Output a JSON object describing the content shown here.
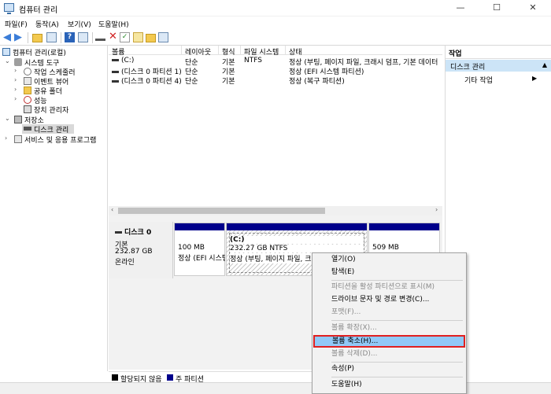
{
  "window": {
    "title": "컴퓨터 관리",
    "min": "—",
    "max": "☐",
    "close": "✕"
  },
  "menu": [
    "파일(F)",
    "동작(A)",
    "보기(V)",
    "도움말(H)"
  ],
  "tree": {
    "root": "컴퓨터 관리(로컬)",
    "system_tools": "시스템 도구",
    "task_scheduler": "작업 스케줄러",
    "event_viewer": "이벤트 뷰어",
    "shared_folders": "공유 폴더",
    "performance": "성능",
    "device_manager": "장치 관리자",
    "storage": "저장소",
    "disk_management": "디스크 관리",
    "services": "서비스 및 응용 프로그램"
  },
  "volume_list": {
    "columns": [
      "볼륨",
      "레이아웃",
      "형식",
      "파일 시스템",
      "상태"
    ],
    "rows": [
      {
        "volume": "(C:)",
        "layout": "단순",
        "type": "기본",
        "fs": "NTFS",
        "status": "정상 (부팅, 페이지 파일, 크래시 덤프, 기본 데이터"
      },
      {
        "volume": "(디스크 0 파티션 1)",
        "layout": "단순",
        "type": "기본",
        "fs": "",
        "status": "정상 (EFI 시스템 파티션)"
      },
      {
        "volume": "(디스크 0 파티션 4)",
        "layout": "단순",
        "type": "기본",
        "fs": "",
        "status": "정상 (복구 파티션)"
      }
    ]
  },
  "disk": {
    "name": "디스크 0",
    "type": "기본",
    "size": "232.87 GB",
    "state": "온라인",
    "partitions": [
      {
        "size": "100 MB",
        "status": "정상 (EFI 시스템)"
      },
      {
        "label": "(C:)",
        "size": "232.27 GB NTFS",
        "status": "정상 (부팅, 페이지 파일, 크래시 덤프)"
      },
      {
        "size": "509 MB",
        "status": ""
      }
    ]
  },
  "legend": [
    "할당되지 않음",
    "주 파티션"
  ],
  "actions": {
    "header": "작업",
    "section": "디스크 관리",
    "item": "기타 작업"
  },
  "context_menu": [
    {
      "label": "열기(O)",
      "disabled": false
    },
    {
      "label": "탐색(E)",
      "disabled": false
    },
    {
      "label": "파티션을 활성 파티션으로 표시(M)",
      "disabled": true
    },
    {
      "label": "드라이브 문자 및 경로 변경(C)...",
      "disabled": false
    },
    {
      "label": "포맷(F)...",
      "disabled": true
    },
    {
      "label": "볼륨 확장(X)...",
      "disabled": true
    },
    {
      "label": "볼륨 축소(H)...",
      "disabled": false,
      "highlighted": true
    },
    {
      "label": "볼륨 삭제(D)...",
      "disabled": true
    },
    {
      "label": "속성(P)",
      "disabled": false
    },
    {
      "label": "도움말(H)",
      "disabled": false
    }
  ],
  "colors": {
    "primary_partition": "#00008b",
    "unallocated": "#000000",
    "selection": "#91c9f7",
    "highlight_border": "#e02020"
  }
}
